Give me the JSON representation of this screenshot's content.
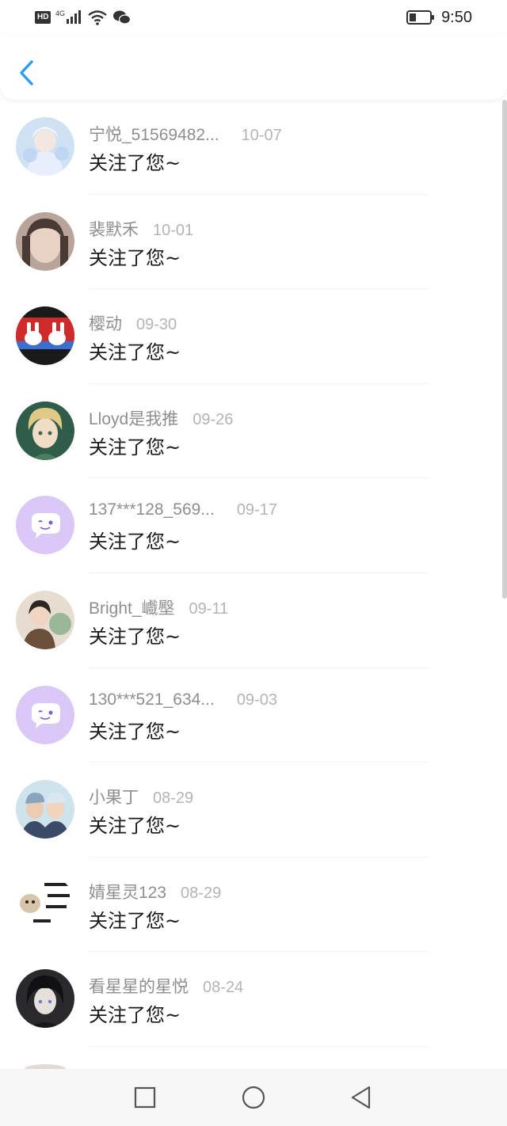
{
  "status_bar": {
    "left_badge": "HD",
    "network": "4G",
    "time": "9:50"
  },
  "header": {
    "back_icon": "chevron-left-icon",
    "accent_color": "#2b9cf0"
  },
  "follow_list": [
    {
      "name": "宁悦_51569482...",
      "date": "10-07",
      "message": "关注了您~",
      "avatar": "anime-angel-avatar"
    },
    {
      "name": "裴默禾",
      "date": "10-01",
      "message": "关注了您~",
      "avatar": "girl-photo-avatar"
    },
    {
      "name": "樱动",
      "date": "09-30",
      "message": "关注了您~",
      "avatar": "bunny-logo-avatar"
    },
    {
      "name": "Lloyd是我推",
      "date": "09-26",
      "message": "关注了您~",
      "avatar": "anime-boy-avatar"
    },
    {
      "name": "137***128_569...",
      "date": "09-17",
      "message": "关注了您~",
      "avatar": "default-chat-avatar"
    },
    {
      "name": "Bright_巇壂",
      "date": "09-11",
      "message": "关注了您~",
      "avatar": "kid-photo-avatar"
    },
    {
      "name": "130***521_634...",
      "date": "09-03",
      "message": "关注了您~",
      "avatar": "default-chat-avatar"
    },
    {
      "name": "小果丁",
      "date": "08-29",
      "message": "关注了您~",
      "avatar": "selfie-photo-avatar"
    },
    {
      "name": "婧星灵123",
      "date": "08-29",
      "message": "关注了您~",
      "avatar": "meme-sticker-avatar"
    },
    {
      "name": "看星星的星悦",
      "date": "08-24",
      "message": "关注了您~",
      "avatar": "dark-anime-avatar"
    }
  ],
  "nav_bar": {
    "recent_icon": "square-icon",
    "home_icon": "circle-icon",
    "back_icon": "triangle-back-icon"
  }
}
